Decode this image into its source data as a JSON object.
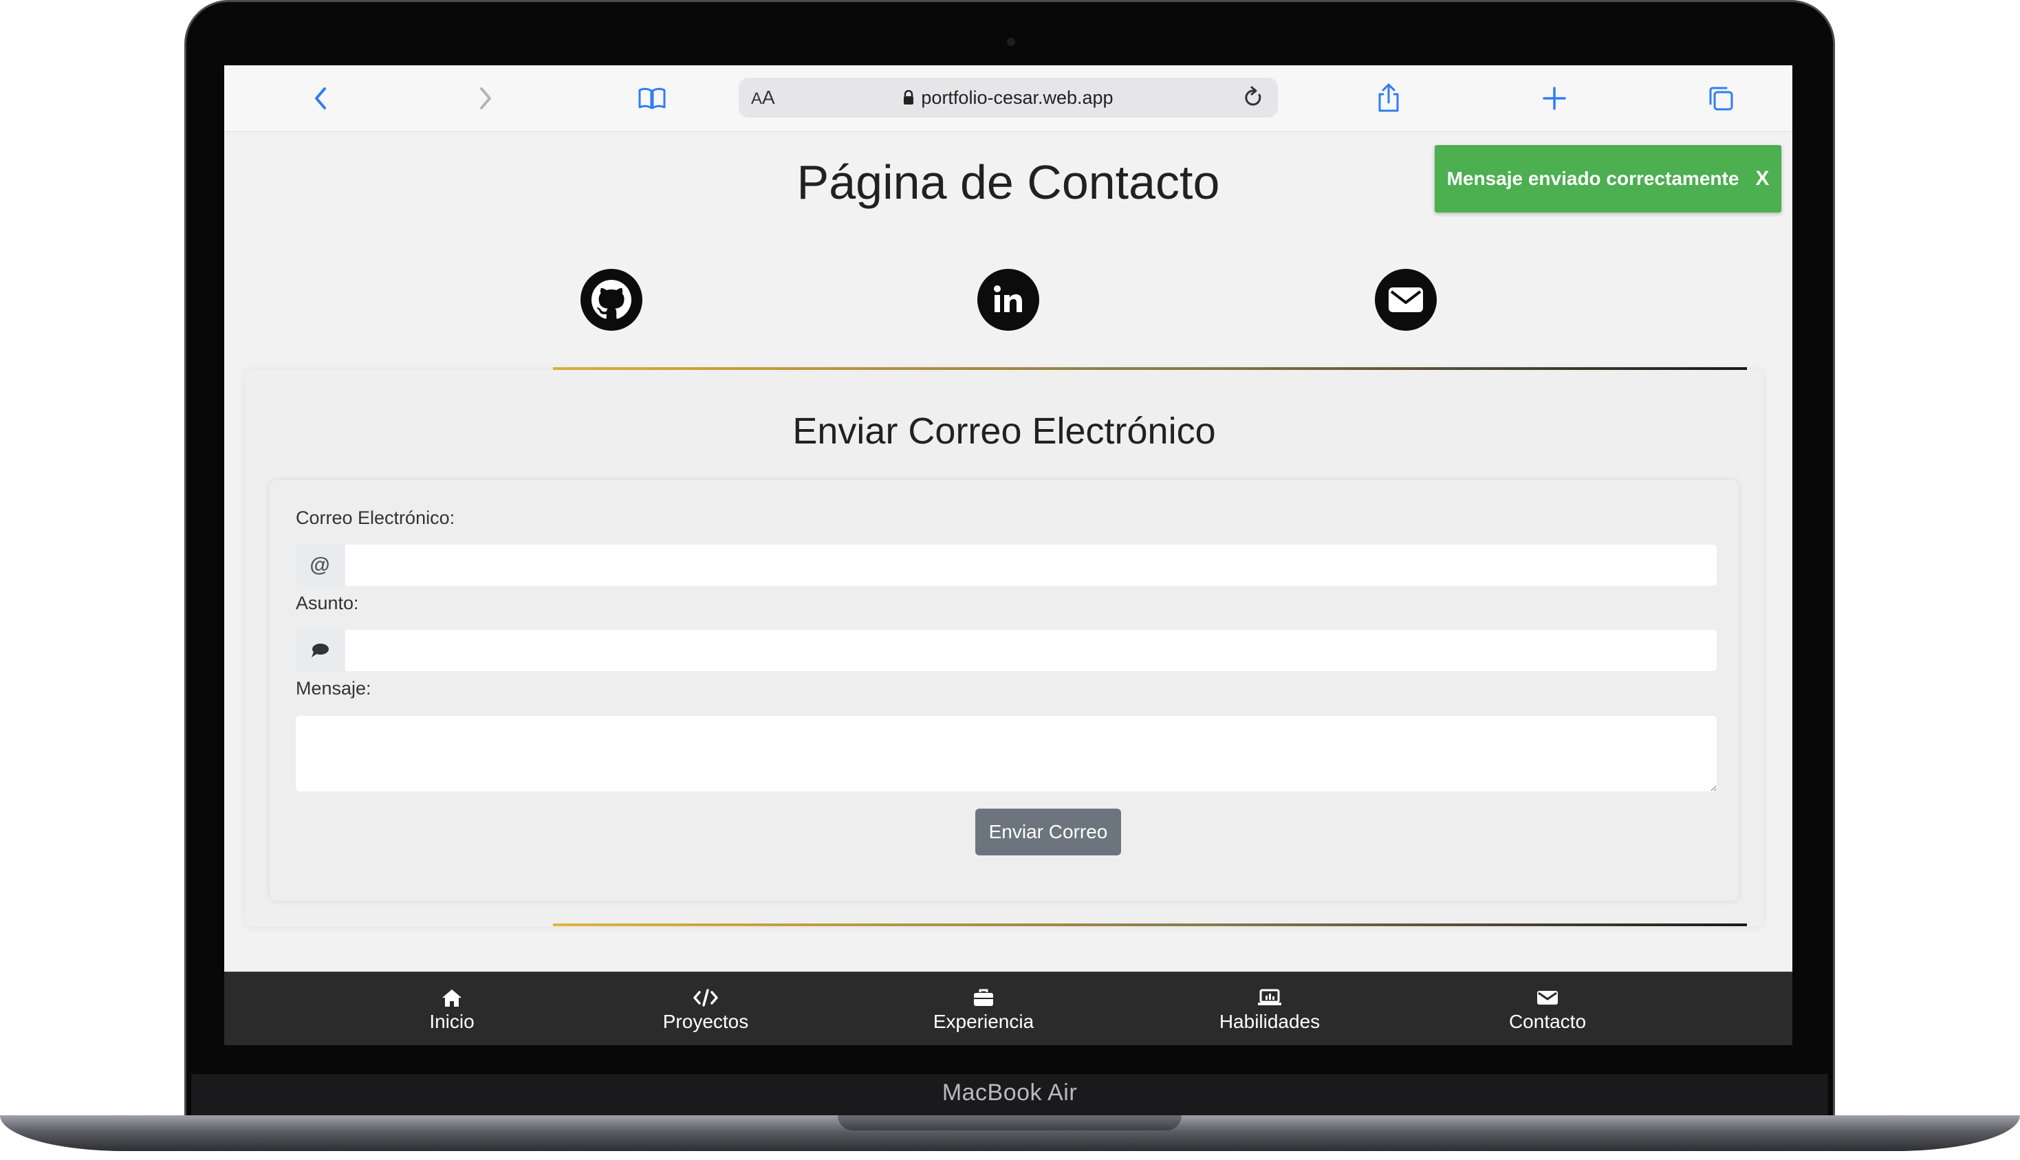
{
  "device": {
    "label": "MacBook Air"
  },
  "browser": {
    "text_size_button": {
      "small": "A",
      "big": "A"
    },
    "url": "portfolio-cesar.web.app",
    "icons": [
      "back-icon",
      "forward-icon",
      "bookmarks-icon",
      "lock-icon",
      "reload-icon",
      "share-icon",
      "new-tab-icon",
      "tabs-icon"
    ]
  },
  "page": {
    "title": "Página de Contacto",
    "toast": {
      "message": "Mensaje enviado correctamente",
      "close_label": "X",
      "color": "#4caf50"
    },
    "social_links": [
      {
        "name": "github",
        "icon": "github-icon"
      },
      {
        "name": "linkedin",
        "icon": "linkedin-icon"
      },
      {
        "name": "email",
        "icon": "envelope-icon"
      }
    ],
    "form": {
      "title": "Enviar Correo Electrónico",
      "email": {
        "label": "Correo Electrónico:",
        "addon": "@",
        "value": ""
      },
      "subject": {
        "label": "Asunto:",
        "addon_icon": "speech-bubble-icon",
        "value": ""
      },
      "message": {
        "label": "Mensaje:",
        "value": ""
      },
      "submit_label": "Enviar Correo"
    }
  },
  "bottom_nav": {
    "items": [
      {
        "label": "Inicio",
        "icon": "home-icon"
      },
      {
        "label": "Proyectos",
        "icon": "code-icon"
      },
      {
        "label": "Experiencia",
        "icon": "briefcase-icon"
      },
      {
        "label": "Habilidades",
        "icon": "laptop-icon"
      },
      {
        "label": "Contacto",
        "icon": "envelope-icon"
      }
    ]
  },
  "colors": {
    "accent_line": "#e2b33c",
    "button": "#6c757d",
    "nav_bg": "#2b2b2b",
    "browser_blue": "#2f7df6"
  }
}
